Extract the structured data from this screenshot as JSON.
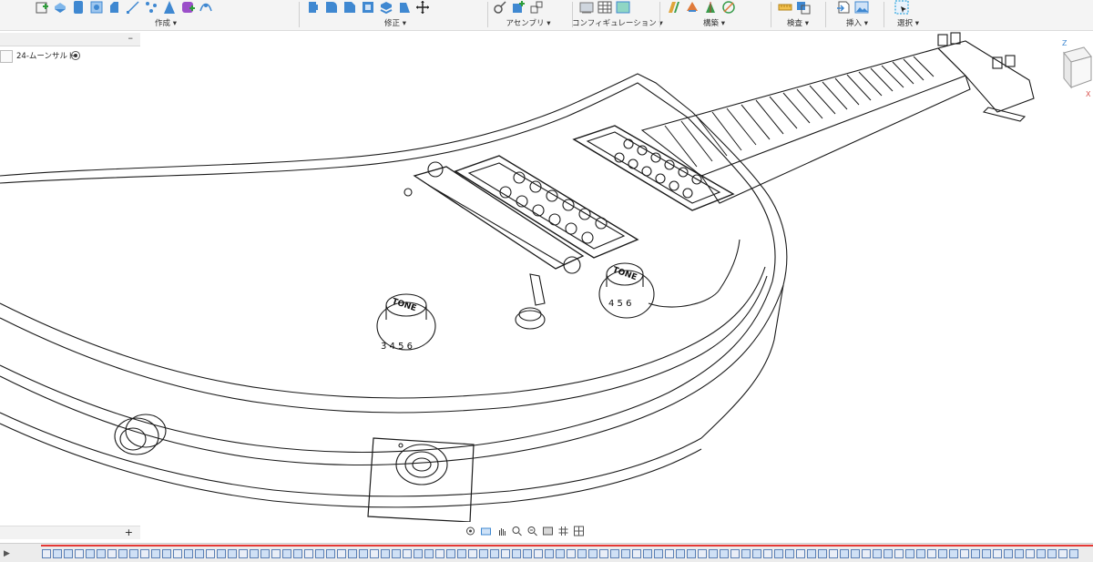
{
  "ribbon": {
    "groups": [
      {
        "label": "作成 ▾",
        "icons": [
          "sketch-create-icon",
          "extrude-icon",
          "revolve-icon",
          "sweep-icon",
          "box-icon",
          "line-icon",
          "point-icon",
          "triangle-icon",
          "form-icon",
          "pattern-icon"
        ]
      },
      {
        "label": "修正 ▾",
        "icons": [
          "press-pull-icon",
          "fillet-icon",
          "chamfer-icon",
          "shell-icon",
          "split-face-icon",
          "draft-icon",
          "move-icon"
        ]
      },
      {
        "label": "アセンブリ ▾",
        "icons": [
          "joint-icon",
          "new-component-icon",
          "rigid-group-icon"
        ]
      },
      {
        "label": "コンフィギュレーション ▾",
        "icons": [
          "configure-icon",
          "table-icon",
          "theme-icon"
        ]
      },
      {
        "label": "構築 ▾",
        "icons": [
          "offset-plane-icon",
          "plane-angle-icon",
          "axis-icon",
          "point-construct-icon"
        ]
      },
      {
        "label": "検査 ▾",
        "icons": [
          "measure-icon",
          "interference-icon"
        ]
      },
      {
        "label": "挿入 ▾",
        "icons": [
          "insert-derive-icon",
          "insert-image-icon"
        ]
      },
      {
        "label": "選択 ▾",
        "icons": [
          "select-window-icon"
        ]
      }
    ]
  },
  "browser": {
    "item_label": "24-ムーンサルト",
    "collapse_symbol": "–"
  },
  "comments": {
    "add_symbol": "+"
  },
  "navbar": {
    "items": [
      "orbit-icon",
      "look-at-icon",
      "pan-icon",
      "zoom-window-icon",
      "zoom-icon",
      "display-settings-icon",
      "grid-icon",
      "viewports-icon"
    ]
  },
  "viewport": {
    "knob_upper_label": "TONE",
    "knob_upper_numbers": "4 5 6",
    "knob_lower_label": "TONE",
    "knob_lower_numbers": "3 4 5 6"
  },
  "viewcube": {
    "axis_z": "Z",
    "axis_x": "X"
  },
  "colors": {
    "accent": "#0696d7",
    "timeline_marker": "#e53935",
    "ribbon_bg": "#f4f4f4"
  }
}
